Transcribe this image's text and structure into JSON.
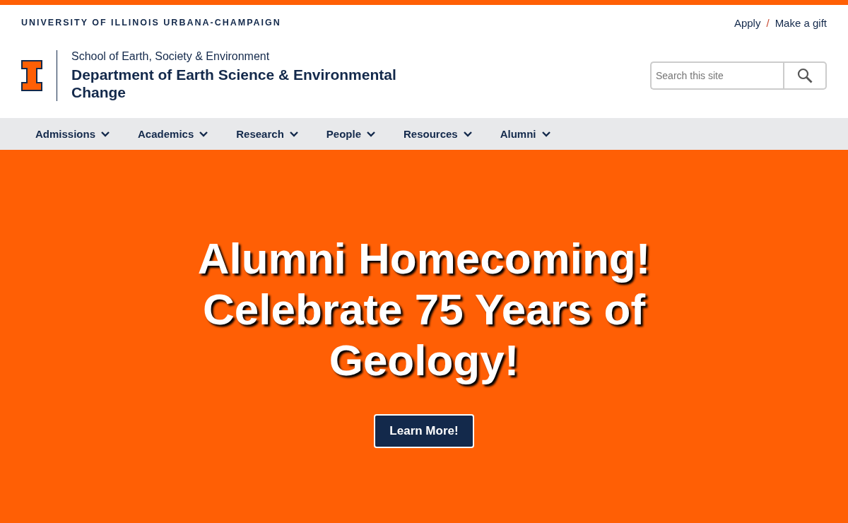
{
  "university": "UNIVERSITY OF ILLINOIS URBANA-CHAMPAIGN",
  "utility_links": [
    {
      "label": "Apply"
    },
    {
      "label": "Make a gift"
    }
  ],
  "utility_separator": "/",
  "unit": {
    "parent": "School of Earth, Society & Environment",
    "title": "Department of Earth Science & Environmental Change"
  },
  "search": {
    "placeholder": "Search this site"
  },
  "nav": [
    {
      "label": "Admissions"
    },
    {
      "label": "Academics"
    },
    {
      "label": "Research"
    },
    {
      "label": "People"
    },
    {
      "label": "Resources"
    },
    {
      "label": "Alumni"
    }
  ],
  "hero": {
    "heading": "Alumni Homecoming! Celebrate 75 Years of Geology!",
    "button": "Learn More!"
  }
}
